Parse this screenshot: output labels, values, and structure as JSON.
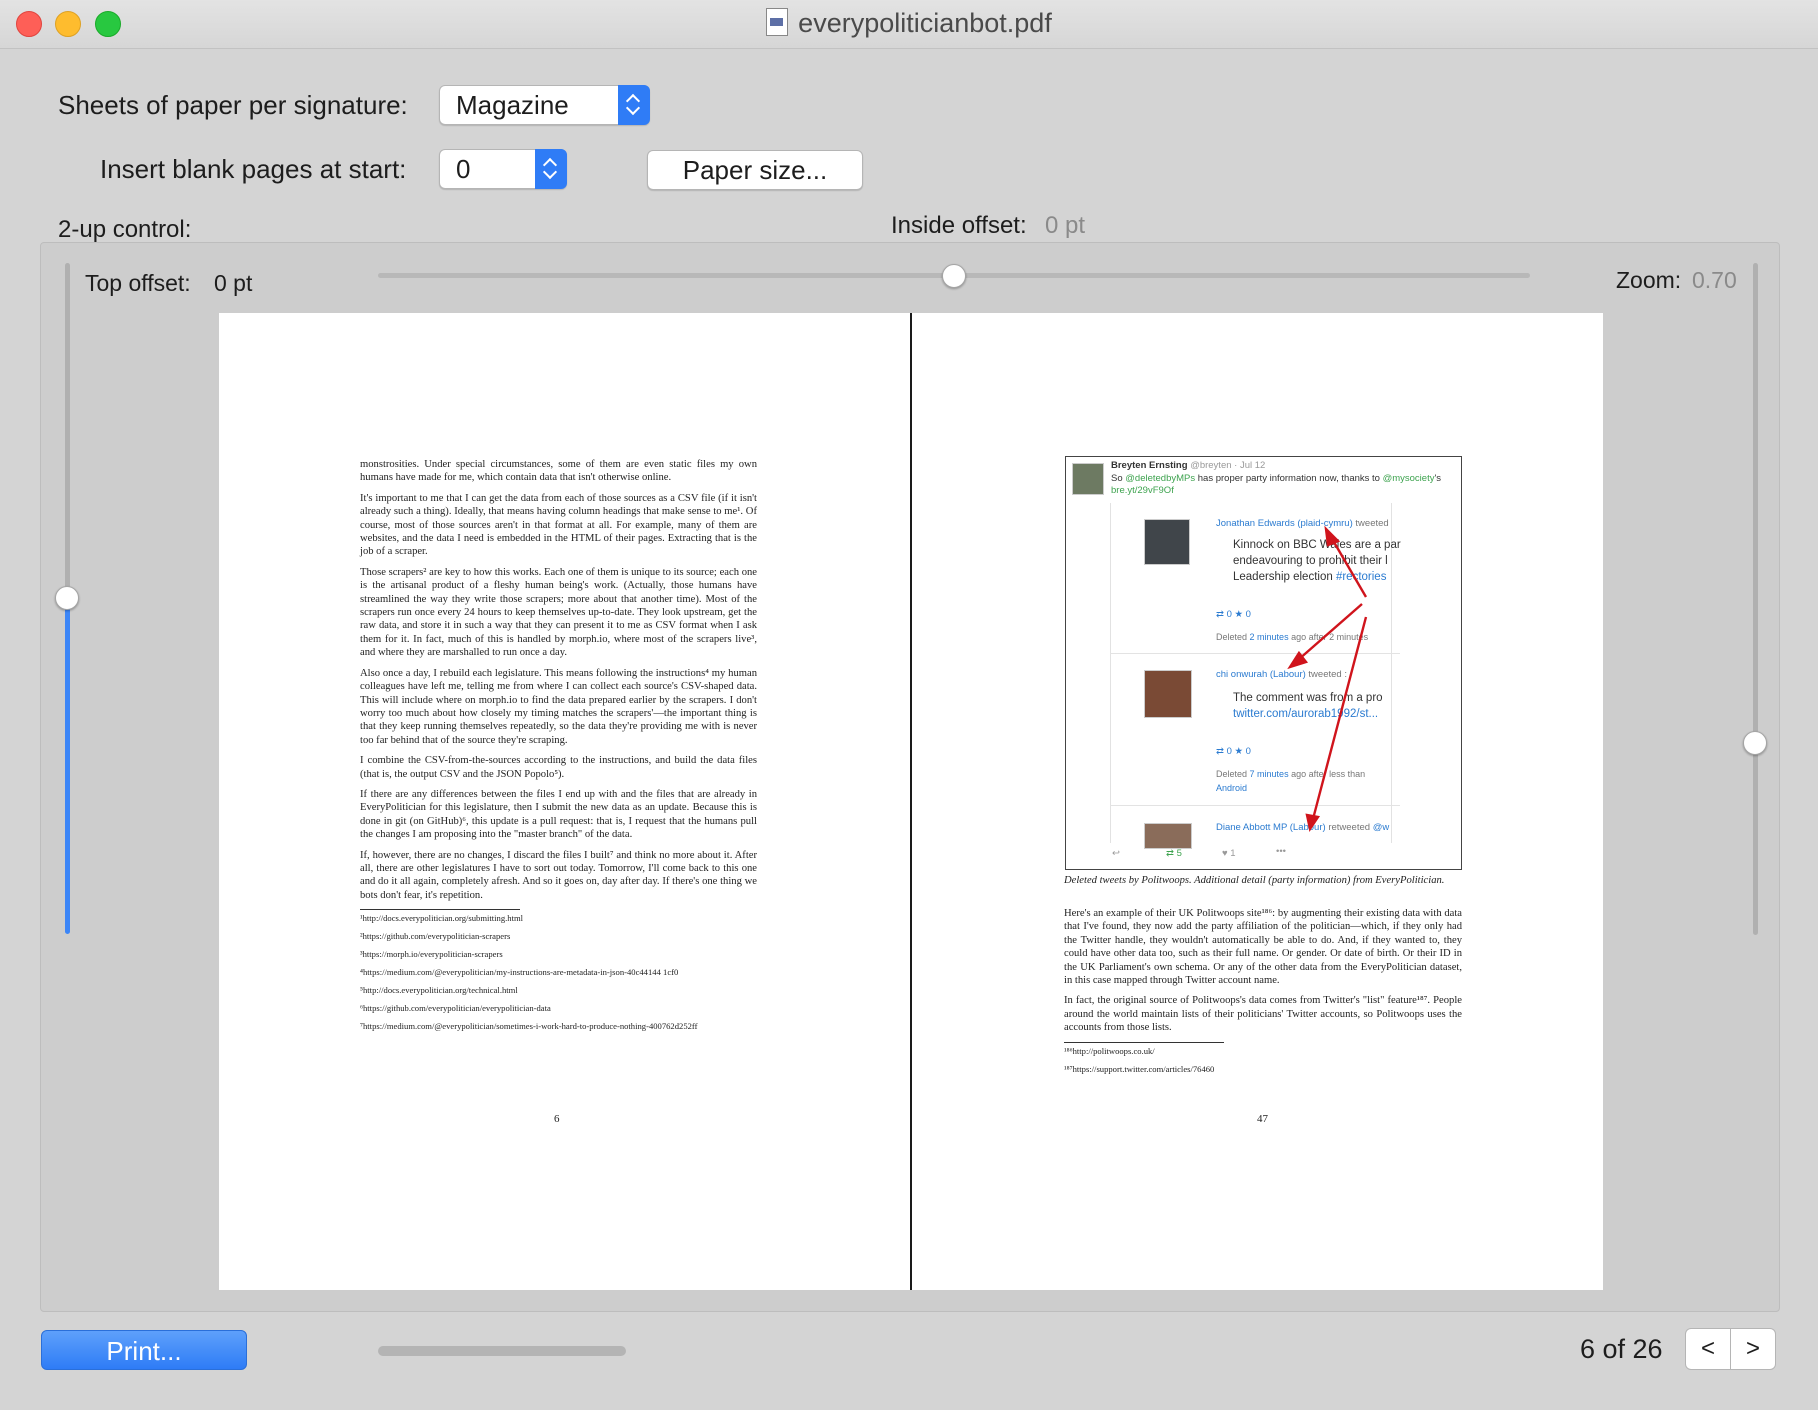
{
  "window": {
    "title": "everypoliticianbot.pdf"
  },
  "signature": {
    "label": "Sheets of paper per signature:",
    "value": "Magazine"
  },
  "blank_pages": {
    "label": "Insert blank pages at start:",
    "value": "0"
  },
  "paper_size_button": "Paper size...",
  "two_up": {
    "label": "2-up control:"
  },
  "inside_offset": {
    "label": "Inside offset:",
    "value": "0 pt"
  },
  "top_offset": {
    "label": "Top offset:",
    "value": "0 pt"
  },
  "zoom": {
    "label": "Zoom:",
    "value": "0.70"
  },
  "left_page": {
    "paragraphs": [
      "monstrosities. Under special circumstances, some of them are even static files my own humans have made for me, which contain data that isn't otherwise online.",
      "It's important to me that I can get the data from each of those sources as a CSV file (if it isn't already such a thing). Ideally, that means having column headings that make sense to me¹. Of course, most of those sources aren't in that format at all. For example, many of them are websites, and the data I need is embedded in the HTML of their pages. Extracting that is the job of a scraper.",
      "Those scrapers² are key to how this works. Each one of them is unique to its source; each one is the artisanal product of a fleshy human being's work. (Actually, those humans have streamlined the way they write those scrapers; more about that another time). Most of the scrapers run once every 24 hours to keep themselves up-to-date. They look upstream, get the raw data, and store it in such a way that they can present it to me as CSV format when I ask them for it. In fact, much of this is handled by morph.io, where most of the scrapers live³, and where they are marshalled to run once a day.",
      "Also once a day, I rebuild each legislature. This means following the instructions⁴ my human colleagues have left me, telling me from where I can collect each source's CSV-shaped data. This will include where on morph.io to find the data prepared earlier by the scrapers. I don't worry too much about how closely my timing matches the scrapers'—the important thing is that they keep running themselves repeatedly, so the data they're providing me with is never too far behind that of the source they're scraping.",
      "I combine the CSV-from-the-sources according to the instructions, and build the data files (that is, the output CSV and the JSON Popolo⁵).",
      "If there are any differences between the files I end up with and the files that are already in EveryPolitician for this legislature, then I submit the new data as an update. Because this is done in git (on GitHub)⁶, this update is a pull request: that is, I request that the humans pull the changes I am proposing into the \"master branch\" of the data.",
      "If, however, there are no changes, I discard the files I built⁷ and think no more about it. After all, there are other legislatures I have to sort out today. Tomorrow, I'll come back to this one and do it all again, completely afresh. And so it goes on, day after day. If there's one thing we bots don't fear, it's repetition."
    ],
    "footnotes": [
      "¹http://docs.everypolitician.org/submitting.html",
      "²https://github.com/everypolitician-scrapers",
      "³https://morph.io/everypolitician-scrapers",
      "⁴https://medium.com/@everypolitician/my-instructions-are-metadata-in-json-40c44144 1cf0",
      "⁵http://docs.everypolitician.org/technical.html",
      "⁶https://github.com/everypolitician/everypolitician-data",
      "⁷https://medium.com/@everypolitician/sometimes-i-work-hard-to-produce-nothing-400762d252ff"
    ],
    "page_number": "6"
  },
  "right_page": {
    "tweet": {
      "author": "Breyten Ernsting",
      "handle": "@breyten · Jul 12",
      "text_prefix": "So",
      "mention1": "@deletedbyMPs",
      "text_mid": "has proper party information now, thanks to",
      "mention2": "@mysociety",
      "text_suffix": "'s",
      "link": "bre.yt/29vF9Of",
      "retweet1_who": "Jonathan Edwards (plaid-cymru)",
      "retweet1_action": "tweeted",
      "retweet1_line1": "Kinnock on BBC Wales are a par",
      "retweet1_line2": "endeavouring to prohibit their l",
      "retweet1_line3": "Leadership election",
      "retweet1_hashtag": "#rectories",
      "retweet1_counts": "⇄ 0   ★ 0",
      "retweet1_deleted_prefix": "Deleted",
      "retweet1_deleted_time": "2 minutes",
      "retweet1_deleted_suffix": "ago after 2 minutes",
      "retweet2_who": "chi onwurah (Labour)",
      "retweet2_action": "tweeted :",
      "retweet2_line1": "The comment was from a pro",
      "retweet2_link": "twitter.com/aurorab1992/st...",
      "retweet2_counts": "⇄ 0   ★ 0",
      "retweet2_deleted_prefix": "Deleted",
      "retweet2_deleted_time": "7 minutes",
      "retweet2_deleted_suffix": "ago after less than",
      "retweet2_client": "Android",
      "retweet3_who": "Diane Abbott MP (Labour)",
      "retweet3_action": "retweeted",
      "retweet3_handle": "@w",
      "footer_retweets": "5",
      "footer_likes": "1"
    },
    "caption": "Deleted tweets by Politwoops. Additional detail (party information) from EveryPolitician.",
    "paragraphs": [
      "Here's an example of their UK Politwoops site¹⁸⁶: by augmenting their existing data with data that I've found, they now add the party affiliation of the politician—which, if they only had the Twitter handle, they wouldn't automatically be able to do. And, if they wanted to, they could have other data too, such as their full name. Or gender. Or date of birth. Or their ID in the UK Parliament's own schema. Or any of the other data from the EveryPolitician dataset, in this case mapped through Twitter account name.",
      "In fact, the original source of Politwoops's data comes from Twitter's \"list\" feature¹⁸⁷. People around the world maintain lists of their politicians' Twitter accounts, so Politwoops uses the accounts from those lists."
    ],
    "footnotes": [
      "¹⁸⁶http://politwoops.co.uk/",
      "¹⁸⁷https://support.twitter.com/articles/76460"
    ],
    "page_number": "47"
  },
  "print_button": "Print...",
  "page_counter": "6 of 26",
  "nav": {
    "prev": "<",
    "next": ">"
  }
}
